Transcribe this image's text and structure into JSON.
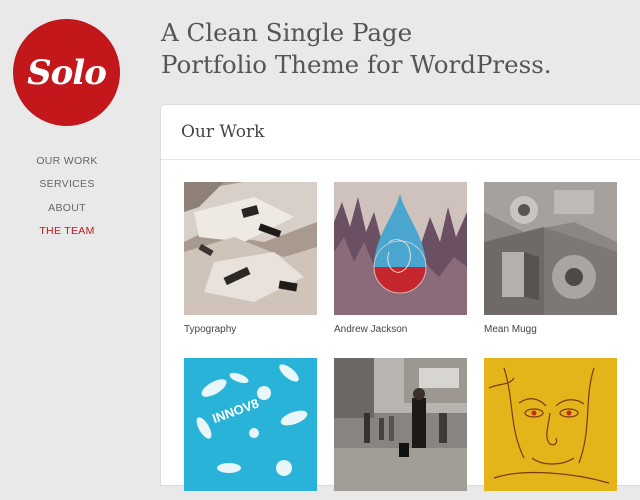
{
  "brand": {
    "logo_text": "Solo",
    "accent": "#c3171c"
  },
  "nav": {
    "items": [
      {
        "label": "OUR WORK",
        "active": false
      },
      {
        "label": "SERVICES",
        "active": false
      },
      {
        "label": "ABOUT",
        "active": false
      },
      {
        "label": "THE TEAM",
        "active": true
      }
    ]
  },
  "tagline": {
    "line1": "A Clean Single Page",
    "line2": "Portfolio Theme for WordPress."
  },
  "section": {
    "title": "Our Work"
  },
  "portfolio": {
    "items": [
      {
        "caption": "Typography",
        "icon": "typography-photo-thumbnail"
      },
      {
        "caption": "Andrew Jackson",
        "icon": "forest-drop-illustration-thumbnail"
      },
      {
        "caption": "Mean Mugg",
        "icon": "stone-lettering-thumbnail"
      },
      {
        "caption": "",
        "icon": "blue-floral-pattern-thumbnail"
      },
      {
        "caption": "",
        "icon": "street-photo-thumbnail"
      },
      {
        "caption": "",
        "icon": "yellow-face-sketch-thumbnail"
      }
    ]
  }
}
